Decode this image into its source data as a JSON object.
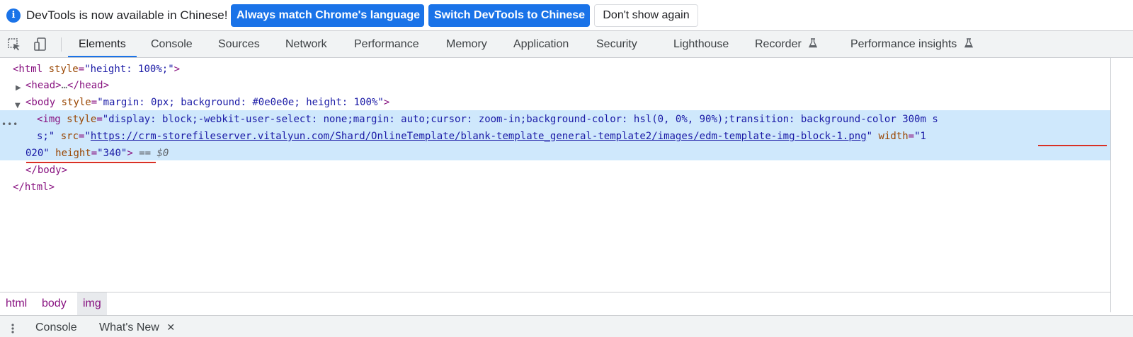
{
  "infobar": {
    "message": "DevTools is now available in Chinese!",
    "btn_match_language": "Always match Chrome's language",
    "btn_switch": "Switch DevTools to Chinese",
    "btn_dont_show": "Don't show again"
  },
  "tabs": {
    "elements": "Elements",
    "console": "Console",
    "sources": "Sources",
    "network": "Network",
    "performance": "Performance",
    "memory": "Memory",
    "application": "Application",
    "security": "Security",
    "lighthouse": "Lighthouse",
    "recorder": "Recorder",
    "performance_insights": "Performance insights"
  },
  "tree": {
    "html_open_tag": "<html",
    "html_attr": "style",
    "html_val": "\"height: 100%;\"",
    "head_open": "<head>",
    "head_ellipsis": "…",
    "head_close": "</head>",
    "body_open_tag": "<body",
    "body_attr": "style",
    "body_val": "\"margin: 0px; background: #0e0e0e; height: 100%\"",
    "img_open_tag": "<img",
    "img_style_attr": "style",
    "img_style_val_1": "\"display: block;-webkit-user-select: none;margin: auto;cursor: zoom-in;background-color: hsl(0, 0%, 90%);transition: background-color 300m",
    "img_style_val_1_overflow": "s",
    "img_style_val_2": "s;\"",
    "img_src_attr": "src",
    "img_src_url": "https://crm-storefileserver.vitalyun.com/Shard/OnlineTemplate/blank-template_general-template2/images/edm-template-img-block-1.png",
    "img_width_attr": "width",
    "img_width_val_1": "\"1",
    "img_width_val_2": "020\"",
    "img_height_attr": "height",
    "img_height_val": "\"340\"",
    "equals_marker": "==",
    "dollar_marker": "$0",
    "body_close": "</body>",
    "html_close": "</html>"
  },
  "breadcrumbs": [
    "html",
    "body",
    "img"
  ],
  "drawer": {
    "console_tab": "Console",
    "whats_new_tab": "What's New"
  },
  "colors": {
    "accent": "#1a73e8",
    "selection": "#cfe8fc",
    "tag": "#881280",
    "attribute": "#994500",
    "value": "#1a1aa6",
    "annotation": "#d93025"
  }
}
